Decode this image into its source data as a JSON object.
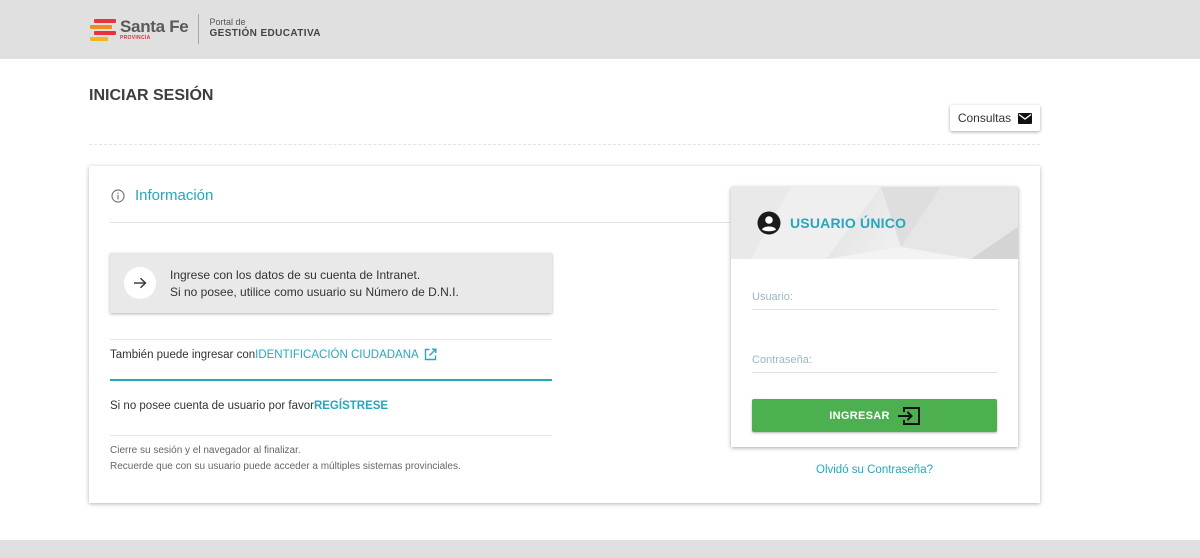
{
  "header": {
    "logo_name": "Santa Fe",
    "logo_sub": "PROVINCIA",
    "portal_line1": "Portal de",
    "portal_line2": "GESTIÓN EDUCATIVA",
    "logo_colors": [
      "#e8333e",
      "#f08c20",
      "#f5b51a"
    ]
  },
  "page": {
    "title": "INICIAR SESIÓN",
    "consultas_label": "Consultas"
  },
  "info": {
    "title": "Información",
    "notice_line1": "Ingrese con los datos de su cuenta de Intranet.",
    "notice_line2": "Si no posee, utilice como usuario su Número de D.N.I.",
    "alt_login_prefix": "También puede ingresar con ",
    "alt_login_link": "IDENTIFICACIÓN CIUDADANA",
    "register_prefix": "Si no posee cuenta de usuario por favor ",
    "register_link": "REGÍSTRESE",
    "footnote_line1": "Cierre su sesión y el navegador al finalizar.",
    "footnote_line2": "Recuerde que con su usuario puede acceder a múltiples sistemas provinciales."
  },
  "login": {
    "title": "USUARIO ÚNICO",
    "user_placeholder": "Usuario:",
    "user_value": "",
    "password_placeholder": "Contraseña:",
    "password_value": "",
    "submit_label": "INGRESAR",
    "forgot_label": "Olvidó su Contraseña?"
  },
  "colors": {
    "accent": "#26a7bd",
    "submit": "#4caf50",
    "header_bg": "#e0e0e0"
  },
  "icons": {
    "logo": "santa-fe-stripes-icon",
    "consultas": "envelope-icon",
    "info": "info-circle-icon",
    "notice": "arrow-right-icon",
    "alt_login": "external-link-icon",
    "user": "account-circle-icon",
    "submit": "login-icon"
  }
}
